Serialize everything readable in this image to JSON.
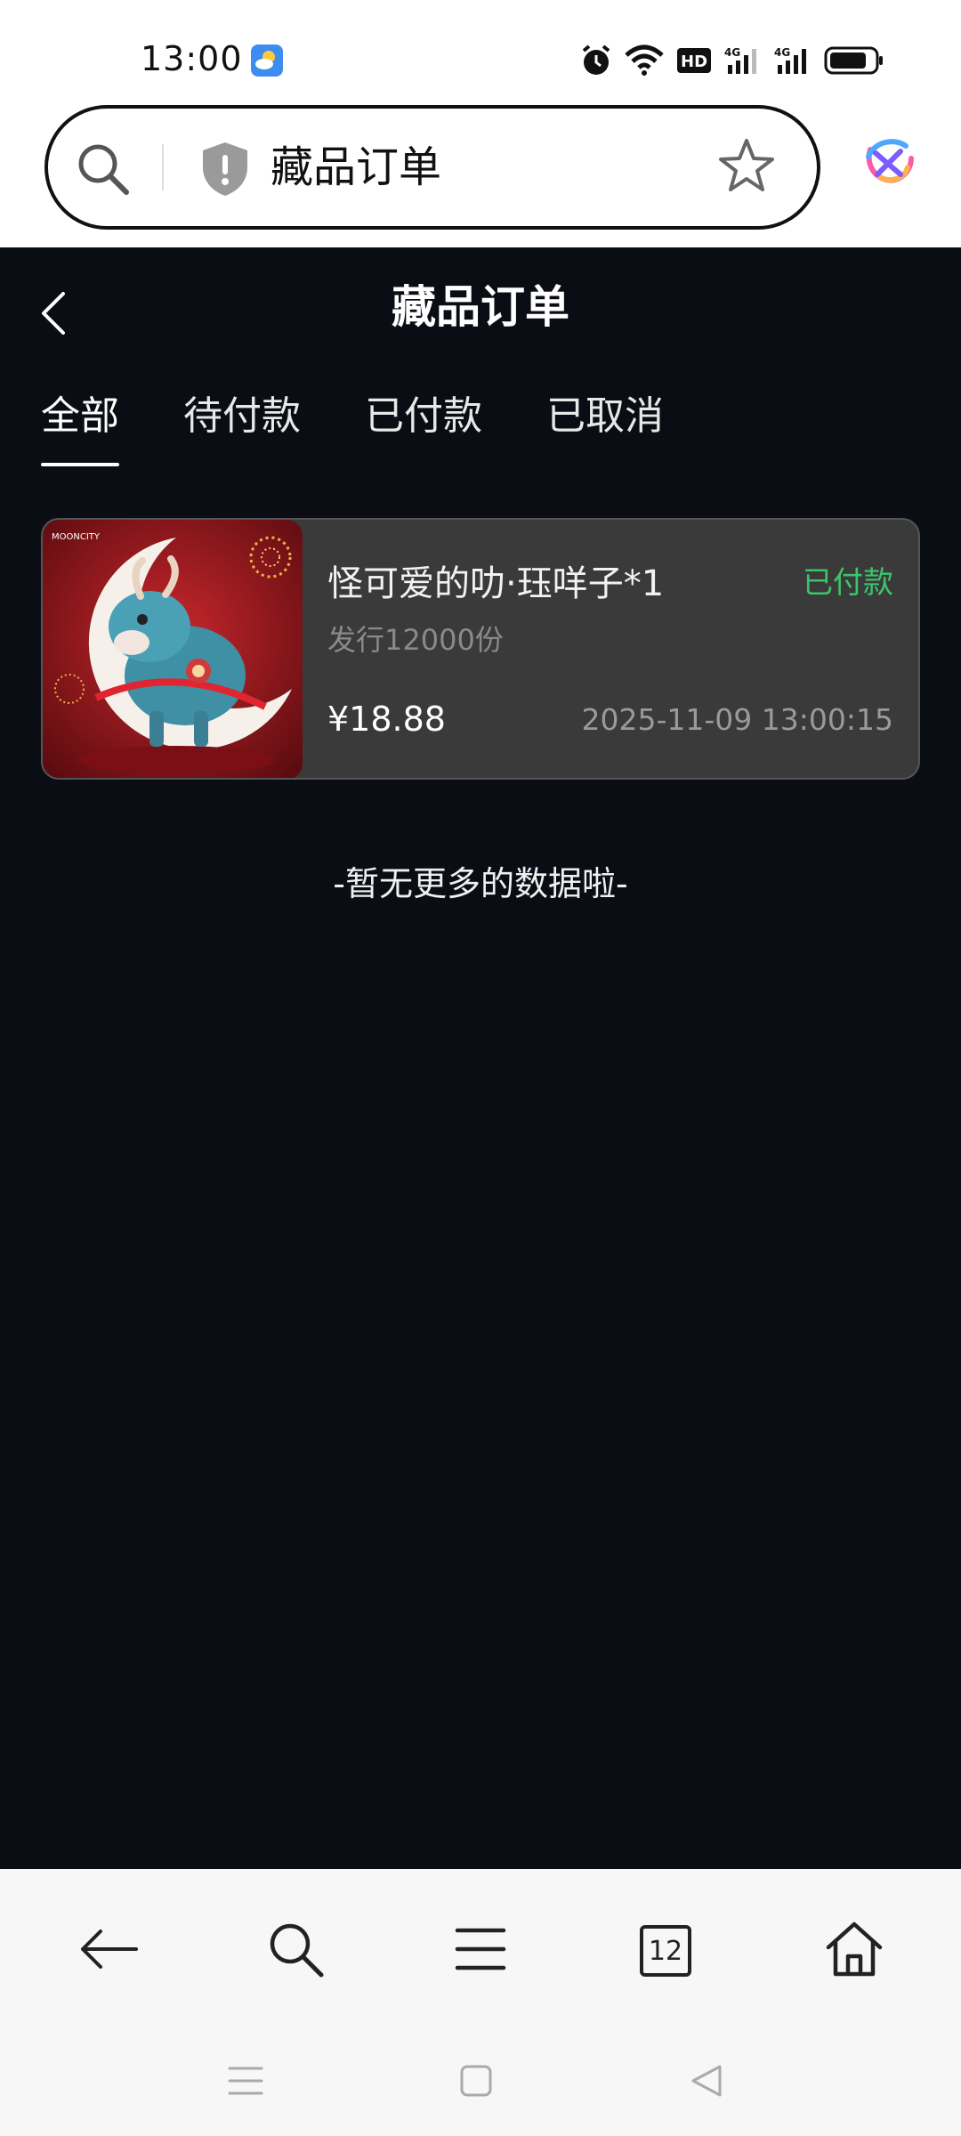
{
  "status_bar": {
    "time": "13:00",
    "icons": [
      "weather-icon",
      "alarm-icon",
      "wifi-icon",
      "hd-icon",
      "signal-4g-icon",
      "signal-4g-icon",
      "battery-icon"
    ]
  },
  "browser": {
    "url_text": "藏品订单",
    "icons": [
      "search-icon",
      "shield-icon",
      "star-icon",
      "app-logo-icon"
    ]
  },
  "page": {
    "title": "藏品订单",
    "tabs": [
      {
        "label": "全部",
        "active": true
      },
      {
        "label": "待付款",
        "active": false
      },
      {
        "label": "已付款",
        "active": false
      },
      {
        "label": "已取消",
        "active": false
      }
    ]
  },
  "orders": [
    {
      "name": "怪可爱的叻·珏咩子*1",
      "status": "已付款",
      "issue": "发行12000份",
      "price": "¥18.88",
      "time": "2025-11-09 13:00:15",
      "thumb_brand": "MOONCITY"
    }
  ],
  "footer_text": "-暂无更多的数据啦-",
  "toolbar": {
    "tab_count": "12",
    "icons": [
      "back-arrow-icon",
      "search-icon",
      "menu-icon",
      "tabs-icon",
      "home-icon"
    ]
  },
  "colors": {
    "app_bg": "#0a0d14",
    "card_bg": "#3a3a3a",
    "status_green": "#3cc46a"
  }
}
